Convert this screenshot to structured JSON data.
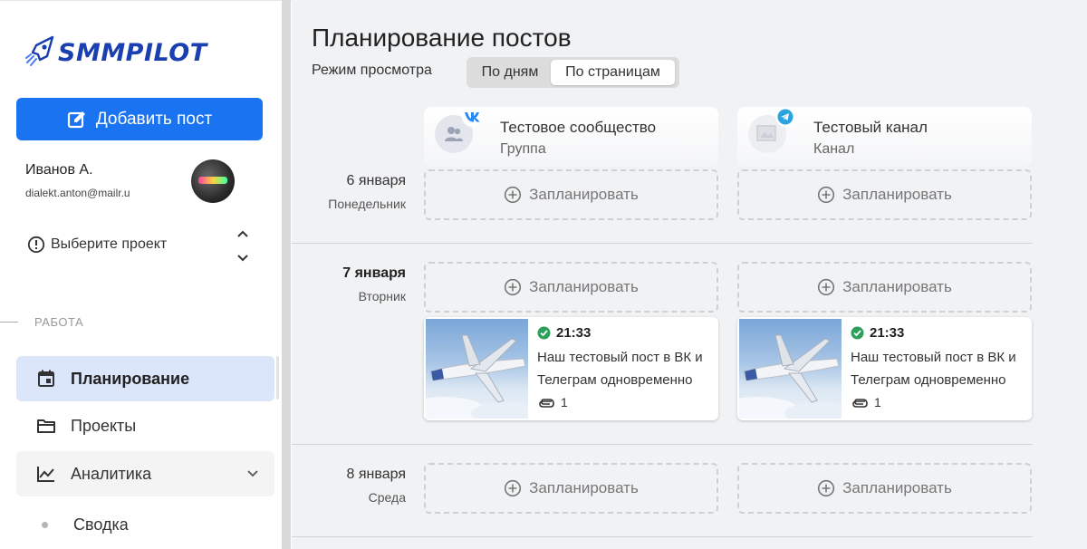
{
  "sidebar": {
    "logo_text": "SMMPILOT",
    "add_post_label": "Добавить пост",
    "user": {
      "name": "Иванов А.",
      "email": "dialekt.anton@mailr.u"
    },
    "project_select": "Выберите проект",
    "section_work": "РАБОТА",
    "nav": {
      "planning": "Планирование",
      "projects": "Проекты",
      "analytics": "Аналитика",
      "summary": "Сводка"
    }
  },
  "main": {
    "title": "Планирование постов",
    "view_mode_label": "Режим просмотра",
    "view_options": {
      "by_days": "По дням",
      "by_pages": "По страницам"
    },
    "pages": [
      {
        "name": "Тестовое сообщество",
        "type": "Группа",
        "network": "vk-icon"
      },
      {
        "name": "Тестовый канал",
        "type": "Канал",
        "network": "telegram-icon"
      }
    ],
    "plan_label": "Запланировать",
    "days": [
      {
        "date": "6 января",
        "weekday": "Понедельник"
      },
      {
        "date": "7 января",
        "weekday": "Вторник"
      },
      {
        "date": "8 января",
        "weekday": "Среда"
      }
    ],
    "posts": [
      {
        "time": "21:33",
        "text": "Наш тестовый пост в ВК и Телеграм одновременно",
        "attachments": "1",
        "status": "published"
      },
      {
        "time": "21:33",
        "text": "Наш тестовый пост в ВК и Телеграм одновременно",
        "attachments": "1",
        "status": "published"
      }
    ]
  },
  "colors": {
    "accent": "#1a73f0",
    "logo": "#1a3fb0",
    "active_nav": "#dbe6fb",
    "status_ok": "#2e9e5b"
  }
}
